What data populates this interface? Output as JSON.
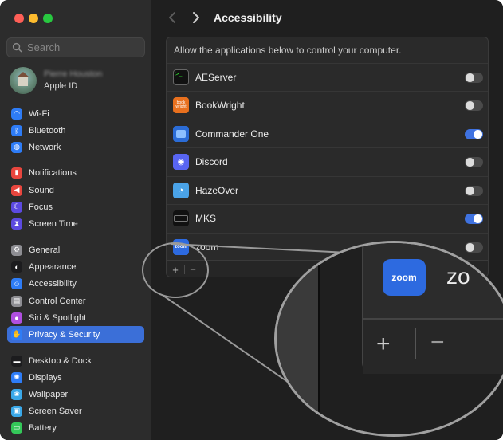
{
  "window": {
    "title": "Accessibility"
  },
  "search": {
    "placeholder": "Search"
  },
  "account": {
    "name": "Pierre Houston",
    "subtitle": "Apple ID"
  },
  "sidebar": {
    "items": [
      {
        "label": "Wi-Fi",
        "icon": "wifi-icon",
        "color": "#2e7cf6"
      },
      {
        "label": "Bluetooth",
        "icon": "bluetooth-icon",
        "color": "#2e7cf6"
      },
      {
        "label": "Network",
        "icon": "globe-icon",
        "color": "#2e7cf6"
      },
      {
        "label": "Notifications",
        "icon": "bell-icon",
        "color": "#e8463e"
      },
      {
        "label": "Sound",
        "icon": "speaker-icon",
        "color": "#e8463e"
      },
      {
        "label": "Focus",
        "icon": "moon-icon",
        "color": "#5c4ae0"
      },
      {
        "label": "Screen Time",
        "icon": "hourglass-icon",
        "color": "#5c4ae0"
      },
      {
        "label": "General",
        "icon": "gear-icon",
        "color": "#8e8e93"
      },
      {
        "label": "Appearance",
        "icon": "appearance-icon",
        "color": "#1c1c1e"
      },
      {
        "label": "Accessibility",
        "icon": "accessibility-icon",
        "color": "#2e7cf6"
      },
      {
        "label": "Control Center",
        "icon": "control-center-icon",
        "color": "#8e8e93"
      },
      {
        "label": "Siri & Spotlight",
        "icon": "siri-icon",
        "color": "#b04fe0"
      },
      {
        "label": "Privacy & Security",
        "icon": "hand-icon",
        "color": "#2e7cf6",
        "active": true
      },
      {
        "label": "Desktop & Dock",
        "icon": "dock-icon",
        "color": "#1c1c1e"
      },
      {
        "label": "Displays",
        "icon": "display-icon",
        "color": "#2e7cf6"
      },
      {
        "label": "Wallpaper",
        "icon": "wallpaper-icon",
        "color": "#3aa8e8"
      },
      {
        "label": "Screen Saver",
        "icon": "screensaver-icon",
        "color": "#3aa8e8"
      },
      {
        "label": "Battery",
        "icon": "battery-icon",
        "color": "#34c759"
      }
    ]
  },
  "main": {
    "description": "Allow the applications below to control your computer.",
    "apps": [
      {
        "name": "AEServer",
        "icon": "terminal-icon",
        "enabled": false
      },
      {
        "name": "BookWright",
        "icon": "bookwright-icon",
        "icon_text": "book wright",
        "enabled": false
      },
      {
        "name": "Commander One",
        "icon": "commander-one-icon",
        "enabled": true
      },
      {
        "name": "Discord",
        "icon": "discord-icon",
        "enabled": false
      },
      {
        "name": "HazeOver",
        "icon": "hazeover-icon",
        "enabled": false
      },
      {
        "name": "MKS",
        "icon": "keyboard-icon",
        "enabled": true
      },
      {
        "name": "zoom",
        "icon": "zoom-icon",
        "icon_text": "zoom",
        "enabled": false
      }
    ],
    "footer": {
      "add": "+",
      "remove": "−"
    }
  },
  "magnifier": {
    "icon_text": "zoom",
    "name_fragment": "zo",
    "add": "+",
    "remove": "−"
  },
  "colors": {
    "accent": "#3b6fd8",
    "toggle_on": "#3f72e0"
  }
}
